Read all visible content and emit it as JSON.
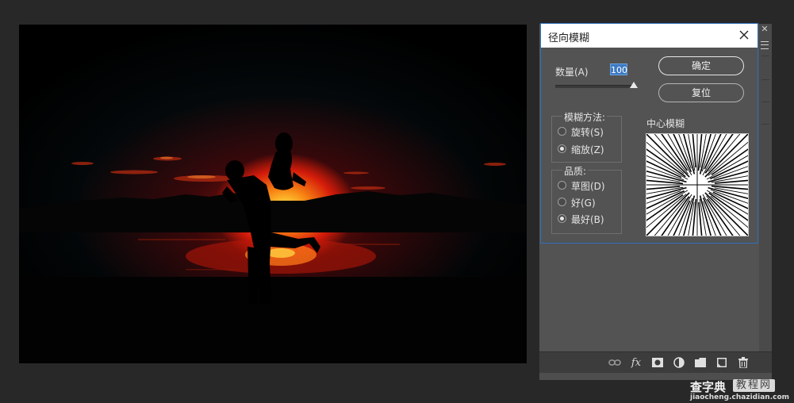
{
  "dialog": {
    "title": "径向模糊",
    "amount_label": "数量(A)",
    "amount_value": "100",
    "amount_slider_fraction": 1.0,
    "ok_label": "确定",
    "reset_label": "复位",
    "method": {
      "title": "模糊方法:",
      "options": [
        "旋转(S)",
        "缩放(Z)"
      ],
      "selected": "缩放(Z)"
    },
    "quality": {
      "title": "品质:",
      "options": [
        "草图(D)",
        "好(G)",
        "最好(B)"
      ],
      "selected": "最好(B)"
    },
    "center_label": "中心模糊"
  },
  "layers_panel": {
    "toolbar_icons": [
      "link-icon",
      "fx-icon",
      "mask-icon",
      "adjustment-icon",
      "folder-icon",
      "new-layer-icon",
      "trash-icon"
    ],
    "fx_label": "fx"
  },
  "watermark": {
    "brand": "查字典",
    "tag": "教程网",
    "url": "jiaocheng.chazidian.com"
  },
  "colors": {
    "ui_background": "#282828",
    "panel": "#535353",
    "dialog_border": "#2f6fb8",
    "input_highlight": "#3d7ac4",
    "sun_core": "#ffeb46",
    "sun_glow": "#eb1e0a"
  }
}
